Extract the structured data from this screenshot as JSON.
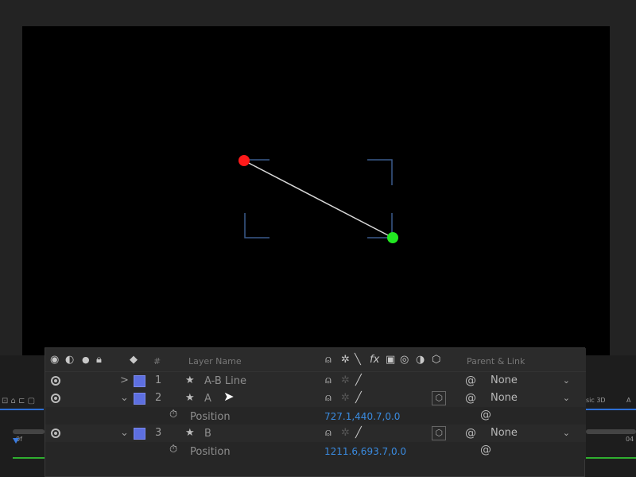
{
  "viewer": {
    "point_a_color": "#ff1a1a",
    "point_b_color": "#22e822",
    "line_color": "#d8d8d8",
    "frame_color": "#3a5a8c"
  },
  "header": {
    "col_number": "#",
    "col_layer_name": "Layer Name",
    "col_parent": "Parent & Link"
  },
  "layers": [
    {
      "number": "1",
      "name": "A-B Line",
      "parent": "None",
      "expander": ">",
      "color": "#5d6fe0"
    },
    {
      "number": "2",
      "name": "A",
      "parent": "None",
      "expander": "⌄",
      "color": "#5d6fe0",
      "property": {
        "name": "Position",
        "value": "727.1,440.7,0.0"
      }
    },
    {
      "number": "3",
      "name": "B",
      "parent": "None",
      "expander": "⌄",
      "color": "#5d6fe0",
      "property": {
        "name": "Position",
        "value": "1211.6,693.7,0.0"
      }
    }
  ],
  "background": {
    "renderer_label": "sic 3D",
    "time_left": "0f",
    "time_right": "04"
  },
  "icons": {
    "visibility": "eye-icon",
    "audio": "speaker-icon",
    "solo": "solo-dot-icon",
    "lock": "lock-icon",
    "label": "tag-icon",
    "stopwatch": "stopwatch-icon",
    "pickwhip": "spiral-icon"
  }
}
